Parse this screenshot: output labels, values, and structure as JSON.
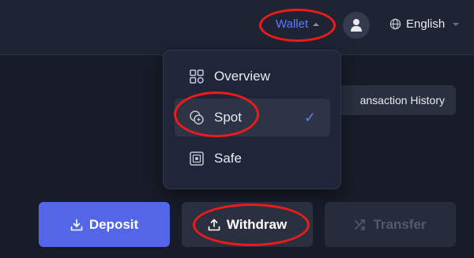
{
  "topbar": {
    "wallet_label": "Wallet",
    "language_label": "English"
  },
  "dropdown": {
    "items": [
      {
        "label": "Overview",
        "icon": "grid-icon",
        "selected": false
      },
      {
        "label": "Spot",
        "icon": "coins-icon",
        "selected": true
      },
      {
        "label": "Safe",
        "icon": "safe-icon",
        "selected": false
      }
    ]
  },
  "main": {
    "transaction_history_label": "ansaction History",
    "deposit_label": "Deposit",
    "withdraw_label": "Withdraw",
    "transfer_label": "Transfer"
  },
  "colors": {
    "accent": "#5b7bff",
    "primary_button": "#5366e8",
    "annotation_red": "#ee1b1b"
  }
}
